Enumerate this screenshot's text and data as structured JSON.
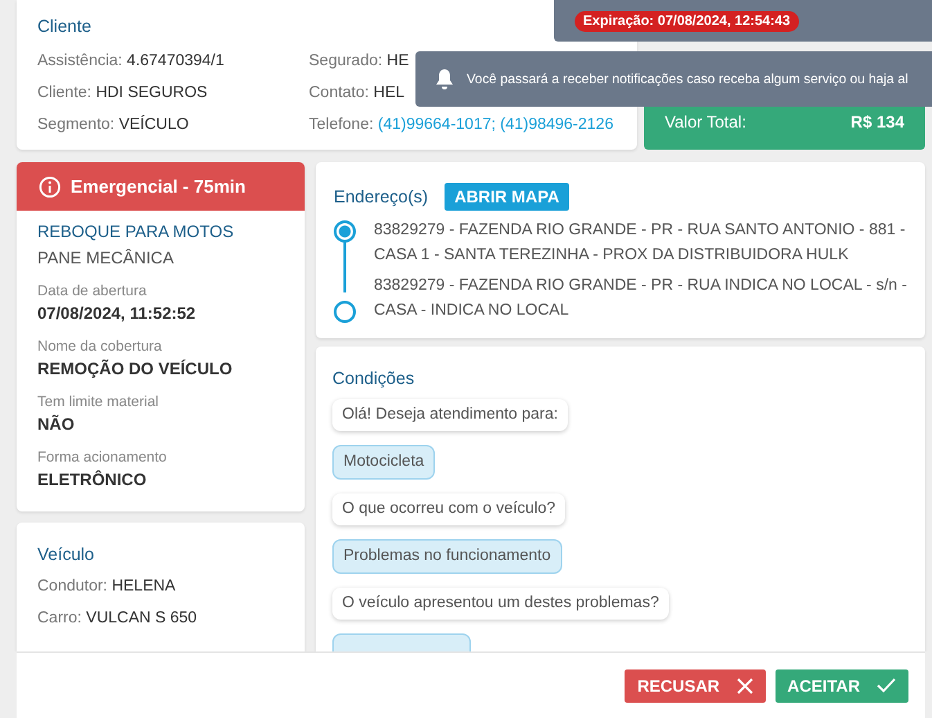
{
  "client": {
    "title": "Cliente",
    "left": [
      {
        "label": "Assistência:",
        "value": "4.67470394/1"
      },
      {
        "label": "Cliente:",
        "value": "HDI SEGUROS"
      },
      {
        "label": "Segmento:",
        "value": "VEÍCULO"
      }
    ],
    "right": [
      {
        "label": "Segurado:",
        "value": "HE",
        "kind": "text"
      },
      {
        "label": "Contato:",
        "value": "HEL",
        "kind": "text"
      },
      {
        "label": "Telefone:",
        "value": "(41)99664-1017; (41)98496-2126",
        "kind": "link"
      }
    ]
  },
  "total": {
    "label": "Valor Total:",
    "value": "R$ 134"
  },
  "toasts": [
    {
      "kind": "expiry",
      "badge": "Expiração: 07/08/2024, 12:54:43"
    },
    {
      "kind": "bell",
      "text": "Você passará a receber notificações caso receba algum serviço ou haja al"
    }
  ],
  "service": {
    "banner": "Emergencial - 75min",
    "title": "REBOQUE PARA MOTOS",
    "subtitle": "PANE MECÂNICA",
    "fields": [
      {
        "label": "Data de abertura",
        "value": "07/08/2024, 11:52:52"
      },
      {
        "label": "Nome da cobertura",
        "value": "REMOÇÃO DO VEÍCULO"
      },
      {
        "label": "Tem limite material",
        "value": "NÃO"
      },
      {
        "label": "Forma acionamento",
        "value": "ELETRÔNICO"
      }
    ]
  },
  "vehicle": {
    "title": "Veículo",
    "rows": [
      {
        "label": "Condutor:",
        "value": "HELENA"
      },
      {
        "label": "Carro:",
        "value": "VULCAN S 650"
      }
    ]
  },
  "addresses": {
    "title": "Endereço(s)",
    "button": "ABRIR MAPA",
    "items": [
      {
        "text": "83829279 - FAZENDA RIO GRANDE - PR - RUA SANTO ANTONIO - 881 - CASA 1 - SANTA TEREZINHA - PROX DA DISTRIBUIDORA HULK",
        "selected": true
      },
      {
        "text": "83829279 - FAZENDA RIO GRANDE - PR - RUA INDICA NO LOCAL - s/n - CASA - INDICA NO LOCAL",
        "selected": false
      }
    ]
  },
  "conditions": {
    "title": "Condições",
    "messages": [
      {
        "kind": "question",
        "text": "Olá! Deseja atendimento para:"
      },
      {
        "kind": "answer",
        "text": "Motocicleta"
      },
      {
        "kind": "question",
        "text": "O que ocorreu com o veículo?"
      },
      {
        "kind": "answer",
        "text": "Problemas no funcionamento"
      },
      {
        "kind": "question",
        "text": "O veículo apresentou um destes problemas?"
      }
    ]
  },
  "buttons": [
    {
      "kind": "refuse",
      "label": "RECUSAR"
    },
    {
      "kind": "accept",
      "label": "ACEITAR"
    }
  ]
}
